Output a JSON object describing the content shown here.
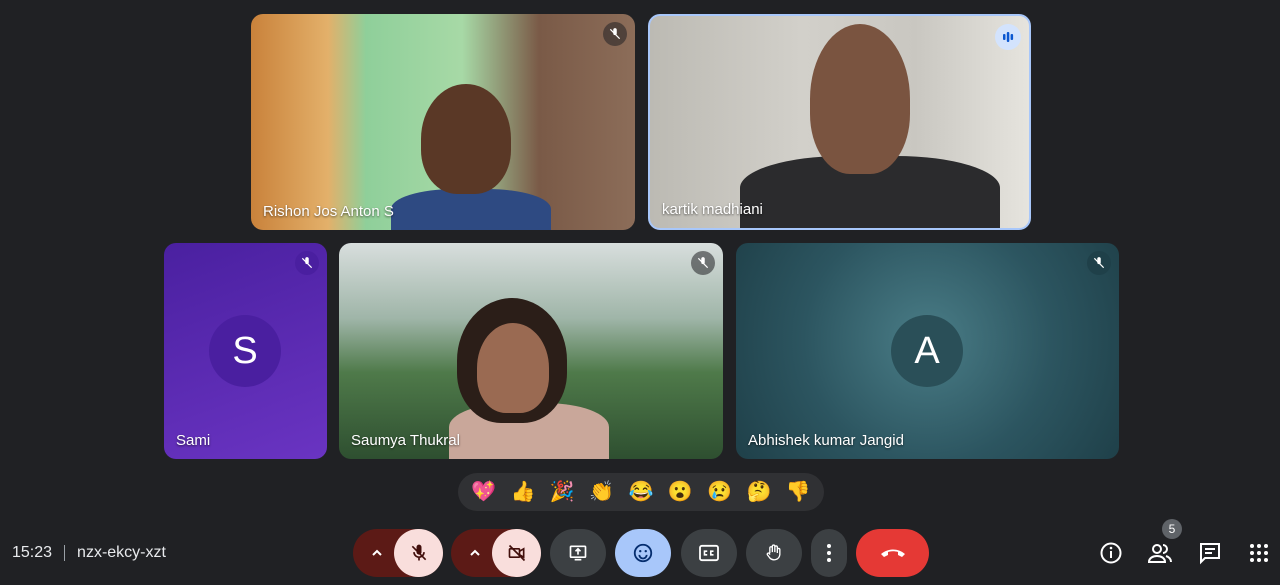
{
  "participants": {
    "rishon": {
      "name": "Rishon Jos Anton S"
    },
    "kartik": {
      "name": "kartik madhiani"
    },
    "sami": {
      "name": "Sami",
      "initial": "S"
    },
    "saumya": {
      "name": "Saumya Thukral"
    },
    "abhishek": {
      "name": "Abhishek kumar Jangid",
      "initial": "A"
    }
  },
  "reactions": [
    "💖",
    "👍",
    "🎉",
    "👏",
    "😂",
    "😮",
    "😢",
    "🤔",
    "👎"
  ],
  "meeting": {
    "time": "15:23",
    "code": "nzx-ekcy-xzt"
  },
  "people_count": "5",
  "icons": {
    "mute": "mic-off-icon",
    "speaking": "audio-level-icon",
    "hangup": "call-end-icon",
    "info": "info-icon",
    "people": "people-icon",
    "chat": "chat-icon",
    "activities": "grid-icon"
  },
  "colors": {
    "sami_tile": "#5b2bb0",
    "abhishek_tile": "#2f5a66",
    "hangup": "#e53935",
    "active_button": "#a8c7fa"
  }
}
